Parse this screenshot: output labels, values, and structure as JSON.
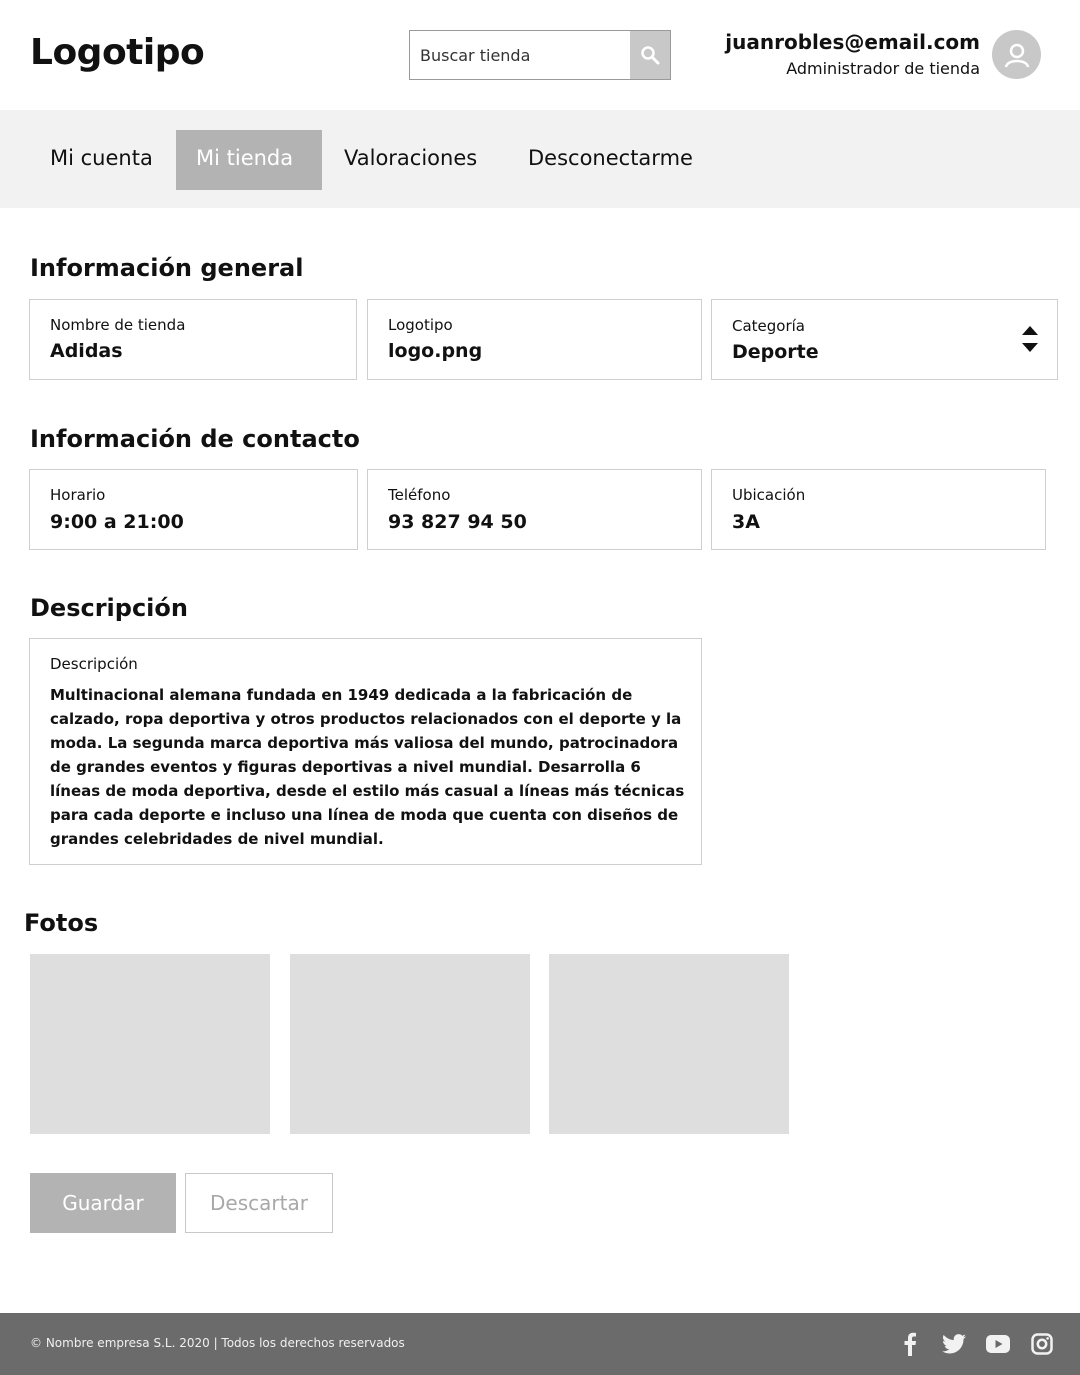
{
  "header": {
    "logo": "Logotipo",
    "search_placeholder": "Buscar tienda",
    "user_email": "juanrobles@email.com",
    "user_role": "Administrador de tienda"
  },
  "nav": {
    "items": [
      {
        "label": "Mi cuenta",
        "active": false
      },
      {
        "label": "Mi tienda",
        "active": true
      },
      {
        "label": "Valoraciones",
        "active": false
      },
      {
        "label": "Desconectarme",
        "active": false
      }
    ]
  },
  "general": {
    "title": "Información general",
    "store_name_label": "Nombre de tienda",
    "store_name_value": "Adidas",
    "logo_label": "Logotipo",
    "logo_value": "logo.png",
    "category_label": "Categoría",
    "category_value": "Deporte"
  },
  "contact": {
    "title": "Información de contacto",
    "schedule_label": "Horario",
    "schedule_value": "9:00 a 21:00",
    "phone_label": "Teléfono",
    "phone_value": "93 827 94 50",
    "location_label": "Ubicación",
    "location_value": "3A"
  },
  "description": {
    "title": "Descripción",
    "field_label": "Descripción",
    "text": "Multinacional alemana fundada en 1949 dedicada a la fabricación de calzado, ropa deportiva y otros productos relacionados con el deporte y la moda. La segunda marca deportiva más valiosa  del mundo, patrocinadora de grandes eventos y figuras deportivas a nivel mundial. Desarrolla 6 líneas de moda deportiva, desde el estilo más casual a líneas más técnicas para cada deporte e incluso una línea de moda que cuenta con diseños de grandes celebridades de nivel mundial."
  },
  "photos": {
    "title": "Fotos",
    "count": 3
  },
  "actions": {
    "save_label": "Guardar",
    "discard_label": "Descartar"
  },
  "footer": {
    "copyright": "© Nombre empresa S.L. 2020 | Todos los derechos reservados",
    "social_icons": [
      "facebook-icon",
      "twitter-icon",
      "youtube-icon",
      "instagram-icon"
    ]
  },
  "colors": {
    "nav_background": "#f2f2f2",
    "active_tab": "#b3b3b3",
    "footer_background": "#6b6b6b",
    "photo_placeholder": "#dedede"
  }
}
